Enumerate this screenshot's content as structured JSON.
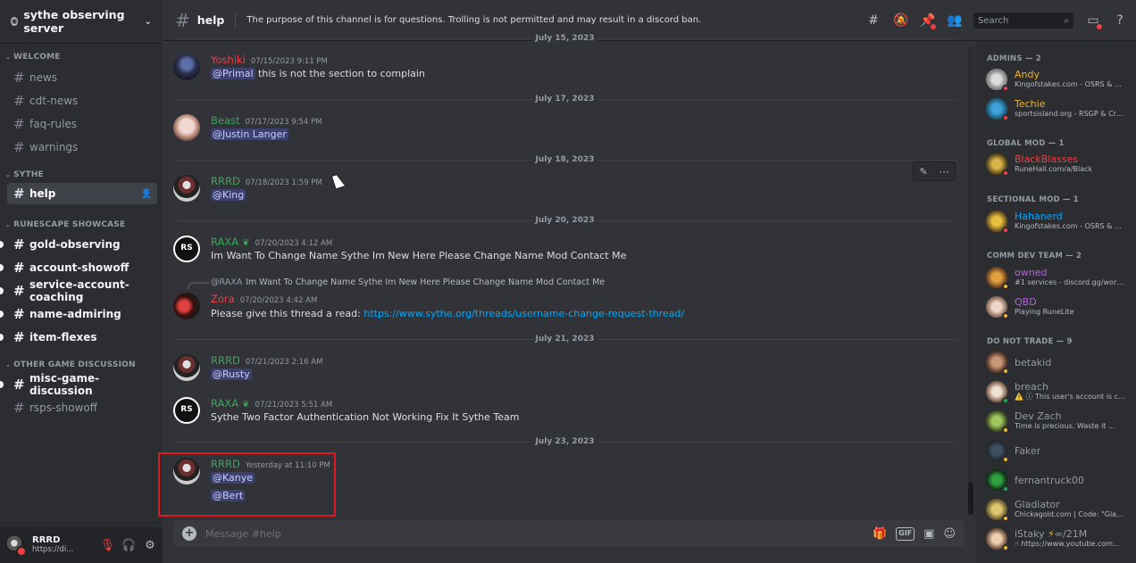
{
  "server": {
    "name": "sythe observing server"
  },
  "sidebar": {
    "categories": [
      {
        "label": "WELCOME",
        "channels": [
          {
            "label": "news"
          },
          {
            "label": "cdt-news"
          },
          {
            "label": "faq-rules"
          },
          {
            "label": "warnings"
          }
        ]
      },
      {
        "label": "SYTHE",
        "channels": [
          {
            "label": "help"
          }
        ]
      },
      {
        "label": "RUNESCAPE SHOWCASE",
        "channels": [
          {
            "label": "gold-observing"
          },
          {
            "label": "account-showoff"
          },
          {
            "label": "service-account-coaching"
          },
          {
            "label": "name-admiring"
          },
          {
            "label": "item-flexes"
          }
        ]
      },
      {
        "label": "OTHER GAME DISCUSSION",
        "channels": [
          {
            "label": "misc-game-discussion"
          },
          {
            "label": "rsps-showoff"
          }
        ]
      }
    ]
  },
  "user_panel": {
    "name": "RRRD",
    "status": "https://di..."
  },
  "topbar": {
    "channel": "help",
    "topic": "The purpose of this channel is for questions. Trolling is not permitted and may result in a discord ban.",
    "search_placeholder": "Search"
  },
  "messages": {
    "separators": [
      "July 15, 2023",
      "July 17, 2023",
      "July 18, 2023",
      "July 20, 2023",
      "July 21, 2023",
      "July 23, 2023"
    ],
    "items": [
      {
        "author": "Yoshiki",
        "color": "#f23f43",
        "time": "07/15/2023 9:11 PM",
        "mention": "@Primal",
        "text": "this is not the section to complain"
      },
      {
        "author": "Beast",
        "color": "#3ba55c",
        "time": "07/17/2023 9:54 PM",
        "mention": "@Justin Langer"
      },
      {
        "author": "RRRD",
        "color": "#3ba55c",
        "time": "07/18/2023 1:59 PM",
        "mention": "@King"
      },
      {
        "author": "RAXA",
        "color": "#3ba55c",
        "time": "07/20/2023 4:12 AM",
        "text": "Im Want To Change Name Sythe Im New Here Please Change Name Mod Contact Me"
      },
      {
        "author": "Zora",
        "color": "#f23f43",
        "time": "07/20/2023 4:42 AM",
        "reply_name": "@RAXA",
        "reply_text": "Im Want To Change Name Sythe Im New Here Please Change Name Mod Contact Me",
        "text": "Please give this thread a read:",
        "link": "https://www.sythe.org/threads/username-change-request-thread/"
      },
      {
        "author": "RRRD",
        "color": "#3ba55c",
        "time": "07/21/2023 2:16 AM",
        "mention": "@Rusty"
      },
      {
        "author": "RAXA",
        "color": "#3ba55c",
        "time": "07/21/2023 5:51 AM",
        "text": "Sythe Two Factor Authentication Not Working Fix It Sythe Team"
      },
      {
        "author": "RRRD",
        "color": "#3ba55c",
        "time": "Yesterday at 11:10 PM",
        "mention": "@Kanye",
        "mention2": "@Bert"
      }
    ]
  },
  "composer": {
    "placeholder": "Message #help"
  },
  "members": {
    "groups": [
      {
        "label": "ADMINS — 2"
      },
      {
        "label": "GLOBAL MOD — 1"
      },
      {
        "label": "SECTIONAL MOD — 1"
      },
      {
        "label": "COMM DEV TEAM — 2"
      },
      {
        "label": "DO NOT TRADE — 9"
      }
    ],
    "list": [
      {
        "name": "Andy",
        "color": "#f0b232",
        "status": "Kingofstakes.com - OSRS & R..."
      },
      {
        "name": "Techie",
        "color": "#f0b232",
        "status": "sportsisland.org - RSGP & Cry..."
      },
      {
        "name": "BlackBlasses",
        "color": "#f23f43",
        "status": "RuneHall.com/a/Black"
      },
      {
        "name": "Hahanerd",
        "color": "#00a8fc",
        "status": "Kingofstakes.com - OSRS & R..."
      },
      {
        "name": "owned",
        "color": "#b464d6",
        "status": "#1 services - discord.gg/wort..."
      },
      {
        "name": "QBD",
        "color": "#b464d6",
        "status": "Playing RuneLite"
      },
      {
        "name": "betakid",
        "color": "#949ba4",
        "status": ""
      },
      {
        "name": "breach",
        "color": "#949ba4",
        "status": "This user's account is c..."
      },
      {
        "name": "Dev Zach",
        "color": "#949ba4",
        "status": "Time is precious. Waste it ..."
      },
      {
        "name": "Faker",
        "color": "#949ba4",
        "status": ""
      },
      {
        "name": "fernantruck00",
        "color": "#949ba4",
        "status": ""
      },
      {
        "name": "Gladiator",
        "color": "#949ba4",
        "status": "Chickagold.com | Code: \"Gladi..."
      },
      {
        "name": "iStaky",
        "color": "#949ba4",
        "status": "https://www.youtube.com..."
      }
    ],
    "istaky_extra": "∞/21M"
  },
  "colors": {
    "accent": "#5865f2",
    "highlight_box": "#e0191f",
    "online": "#23a55a",
    "dnd": "#f23f43",
    "idle": "#f0b232"
  }
}
